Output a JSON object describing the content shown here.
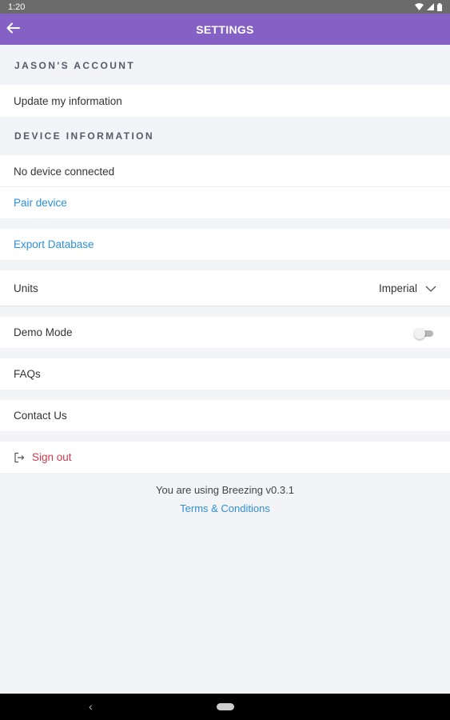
{
  "status_bar": {
    "time": "1:20"
  },
  "app_bar": {
    "title": "SETTINGS",
    "back_icon": "arrow-left-icon"
  },
  "sections": {
    "account_header": "JASON'S ACCOUNT",
    "device_header": "DEVICE INFORMATION"
  },
  "account": {
    "update_label": "Update my information"
  },
  "device": {
    "status": "No device connected",
    "pair_label": "Pair device"
  },
  "export": {
    "label": "Export Database"
  },
  "units": {
    "label": "Units",
    "value": "Imperial"
  },
  "demo_mode": {
    "label": "Demo Mode",
    "enabled": false
  },
  "faqs": {
    "label": "FAQs"
  },
  "contact": {
    "label": "Contact Us"
  },
  "sign_out": {
    "label": "Sign out"
  },
  "footer": {
    "version_text": "You are using Breezing v0.3.1",
    "terms_label": "Terms & Conditions"
  },
  "colors": {
    "app_bar": "#8561c5",
    "link": "#2d8fd8",
    "danger": "#cf3a4c",
    "background": "#f3f4f8"
  }
}
